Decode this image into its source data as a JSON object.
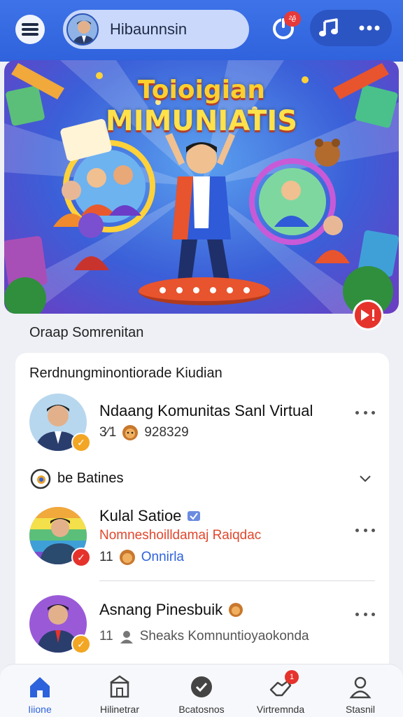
{
  "header": {
    "profile_name": "Hibaunnsin",
    "notification_badge": "²ê",
    "accent_color": "#3e73e8",
    "icons": [
      "menu-icon",
      "avatar",
      "power-icon",
      "music-icon",
      "more-icon"
    ]
  },
  "banner": {
    "title_line1": "Toioigian",
    "title_line2": "MIMUNIATIS",
    "play_badge": "!"
  },
  "group_label": "Oraap Somrenitan",
  "card": {
    "title": "Rerdnungminontiorade Kiudian",
    "items": [
      {
        "name": "Ndaang Komunitas Sanl Virtual",
        "sub_count": "3⁄1",
        "sub_text": "928329",
        "badge_color": "#f2a623",
        "subtitle": ""
      },
      {
        "name": "Kulal Satioe",
        "subtitle": "Nomneshoilldamaj Raiqdac",
        "sub_count": "11",
        "sub_text": "Onnirla",
        "badge_color": "#e5332c"
      },
      {
        "name": "Asnang Pinesbuik",
        "sub_count": "11",
        "sub_text": "Sheaks Komnuntioyaokonda",
        "badge_color": "#f2a623",
        "subtitle": ""
      }
    ],
    "filter_label": "be Batines"
  },
  "bottom_nav": {
    "items": [
      {
        "label": "Iiione",
        "icon": "home-icon",
        "active": true
      },
      {
        "label": "Hilinetrar",
        "icon": "store-icon",
        "active": false
      },
      {
        "label": "Bcatosnos",
        "icon": "check-shield-icon",
        "active": false
      },
      {
        "label": "Virtremnda",
        "icon": "handshake-icon",
        "active": false,
        "badge": "1"
      },
      {
        "label": "Stasnil",
        "icon": "person-icon",
        "active": false
      }
    ],
    "active_color": "#2c62dc"
  }
}
